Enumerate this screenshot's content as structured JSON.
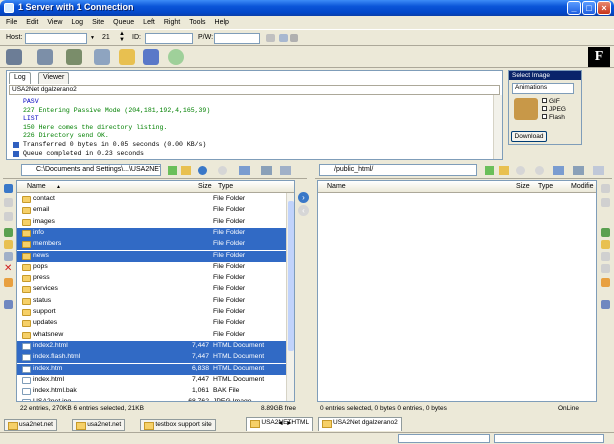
{
  "window": {
    "title": "1 Server with 1 Connection"
  },
  "menu": [
    "File",
    "Edit",
    "View",
    "Log",
    "Site",
    "Queue",
    "Left",
    "Right",
    "Tools",
    "Help"
  ],
  "connection": {
    "host_label": "Host:",
    "port_value": "21",
    "id_label": "ID:",
    "pw_label": "P/W:"
  },
  "log": {
    "tabs": [
      "Log",
      "Viewer"
    ],
    "session": "USA2Net dgalzerano2",
    "lines": [
      {
        "text": "PASV",
        "color": "#0000c0"
      },
      {
        "text": "227 Entering Passive Mode (204,181,192,4,165,39)",
        "color": "#008000"
      },
      {
        "text": "LIST",
        "color": "#0000c0"
      },
      {
        "text": "150 Here comes the directory listing.",
        "color": "#008000"
      },
      {
        "text": "226 Directory send OK.",
        "color": "#008000"
      },
      {
        "text": "Transferred 0 bytes in 0.05 seconds (0.00 KB/s)",
        "color": "#000000"
      },
      {
        "text": "Queue completed in 0.23 seconds",
        "color": "#000000"
      }
    ]
  },
  "select_image": {
    "title": "Select Image",
    "dropdown": "Animations",
    "options": [
      "GIF",
      "JPEG",
      "Flash"
    ],
    "button": "Download"
  },
  "left": {
    "path": "C:\\Documents and Settings\\...\\USA2NETHTML",
    "columns": {
      "name": "Name",
      "size": "Size",
      "type": "Type"
    },
    "rows": [
      {
        "name": "contact",
        "size": "",
        "type": "File Folder",
        "sel": false,
        "kind": "folder"
      },
      {
        "name": "email",
        "size": "",
        "type": "File Folder",
        "sel": false,
        "kind": "folder"
      },
      {
        "name": "images",
        "size": "",
        "type": "File Folder",
        "sel": false,
        "kind": "folder"
      },
      {
        "name": "info",
        "size": "",
        "type": "File Folder",
        "sel": true,
        "kind": "folder"
      },
      {
        "name": "members",
        "size": "",
        "type": "File Folder",
        "sel": true,
        "kind": "folder"
      },
      {
        "name": "news",
        "size": "",
        "type": "File Folder",
        "sel": true,
        "kind": "folder"
      },
      {
        "name": "pops",
        "size": "",
        "type": "File Folder",
        "sel": false,
        "kind": "folder"
      },
      {
        "name": "press",
        "size": "",
        "type": "File Folder",
        "sel": false,
        "kind": "folder"
      },
      {
        "name": "services",
        "size": "",
        "type": "File Folder",
        "sel": false,
        "kind": "folder"
      },
      {
        "name": "status",
        "size": "",
        "type": "File Folder",
        "sel": false,
        "kind": "folder"
      },
      {
        "name": "support",
        "size": "",
        "type": "File Folder",
        "sel": false,
        "kind": "folder"
      },
      {
        "name": "updates",
        "size": "",
        "type": "File Folder",
        "sel": false,
        "kind": "folder"
      },
      {
        "name": "whatsnew",
        "size": "",
        "type": "File Folder",
        "sel": false,
        "kind": "folder"
      },
      {
        "name": "index2.html",
        "size": "7,447",
        "type": "HTML Document",
        "sel": true,
        "kind": "file"
      },
      {
        "name": "index.flash.html",
        "size": "7,447",
        "type": "HTML Document",
        "sel": true,
        "kind": "file"
      },
      {
        "name": "index.htm",
        "size": "6,838",
        "type": "HTML Document",
        "sel": true,
        "kind": "file"
      },
      {
        "name": "index.html",
        "size": "7,447",
        "type": "HTML Document",
        "sel": false,
        "kind": "file"
      },
      {
        "name": "index.html.bak",
        "size": "1,061",
        "type": "BAK File",
        "sel": false,
        "kind": "file"
      },
      {
        "name": "USA2net.jpg",
        "size": "68,762",
        "type": "JPEG Image",
        "sel": false,
        "kind": "file"
      },
      {
        "name": "USA2Netlinks83.swf",
        "size": "100,149",
        "type": "Shockwave Flash Objec",
        "sel": false,
        "kind": "file"
      }
    ],
    "status": "22 entries, 270KB  6 entries selected, 21KB",
    "free": "8.89GB free"
  },
  "right": {
    "path": "/public_html/",
    "columns": {
      "name": "Name",
      "size": "Size",
      "type": "Type",
      "modified": "Modifie"
    },
    "status": "0 entries selected, 0 bytes  0 entries, 0 bytes",
    "online": "OnLine"
  },
  "bottom_tabs_left": [
    "usa2net.net",
    "usa2net.net",
    "testbox support site",
    "USA2NETHTML"
  ],
  "bottom_tabs_right": [
    "USA2Net dgalzerano2"
  ]
}
